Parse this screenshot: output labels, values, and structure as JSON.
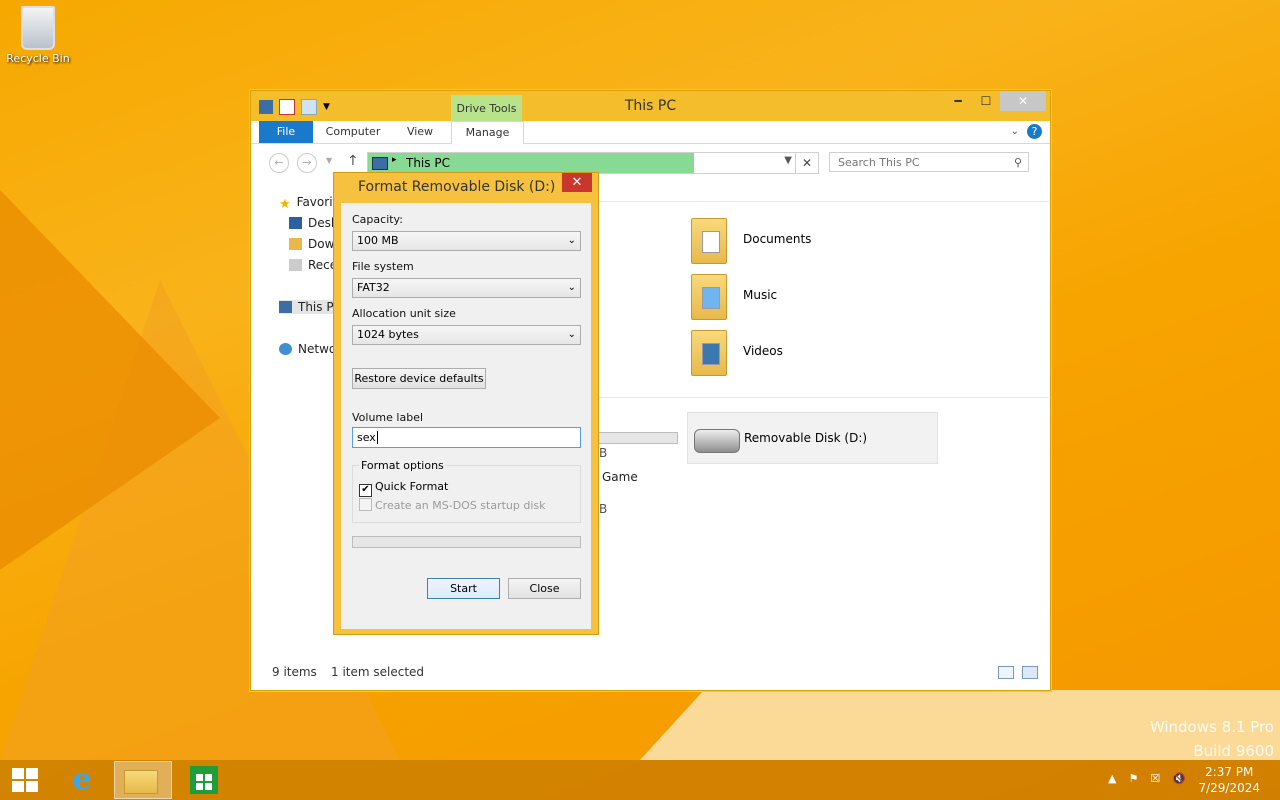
{
  "desktop": {
    "recycle_bin_label": "Recycle Bin",
    "watermark_line1": "Windows 8.1 Pro",
    "watermark_line2": "Build 9600"
  },
  "explorer": {
    "title": "This PC",
    "context_tab_group": "Drive Tools",
    "ribbon_tabs": [
      "File",
      "Computer",
      "View",
      "Manage"
    ],
    "address": "This PC",
    "search_placeholder": "Search This PC",
    "nav_items": [
      "Favorites",
      "Desktop",
      "Downloads",
      "Recent places",
      "This PC",
      "Network"
    ],
    "folders": [
      "Documents",
      "Music",
      "Videos"
    ],
    "devices": [
      {
        "label": "Removable Disk (D:)"
      }
    ],
    "partial_texts": [
      "B",
      "Game",
      "B"
    ],
    "status": {
      "items": "9 items",
      "selected": "1 item selected"
    }
  },
  "dialog": {
    "title": "Format Removable Disk (D:)",
    "close_glyph": "✕",
    "capacity_label": "Capacity:",
    "capacity_value": "100 MB",
    "fs_label": "File system",
    "fs_value": "FAT32",
    "alloc_label": "Allocation unit size",
    "alloc_value": "1024 bytes",
    "restore_label": "Restore device defaults",
    "volume_label": "Volume label",
    "volume_value": "sex",
    "format_options_label": "Format options",
    "quick_format_label": "Quick Format",
    "quick_format_checked": true,
    "msdos_label": "Create an MS-DOS startup disk",
    "msdos_checked": false,
    "progress": 0,
    "start_label": "Start",
    "close_label": "Close"
  },
  "taskbar": {
    "time": "2:37 PM",
    "date": "7/29/2024",
    "apps": [
      "internet-explorer",
      "file-explorer",
      "store"
    ]
  }
}
